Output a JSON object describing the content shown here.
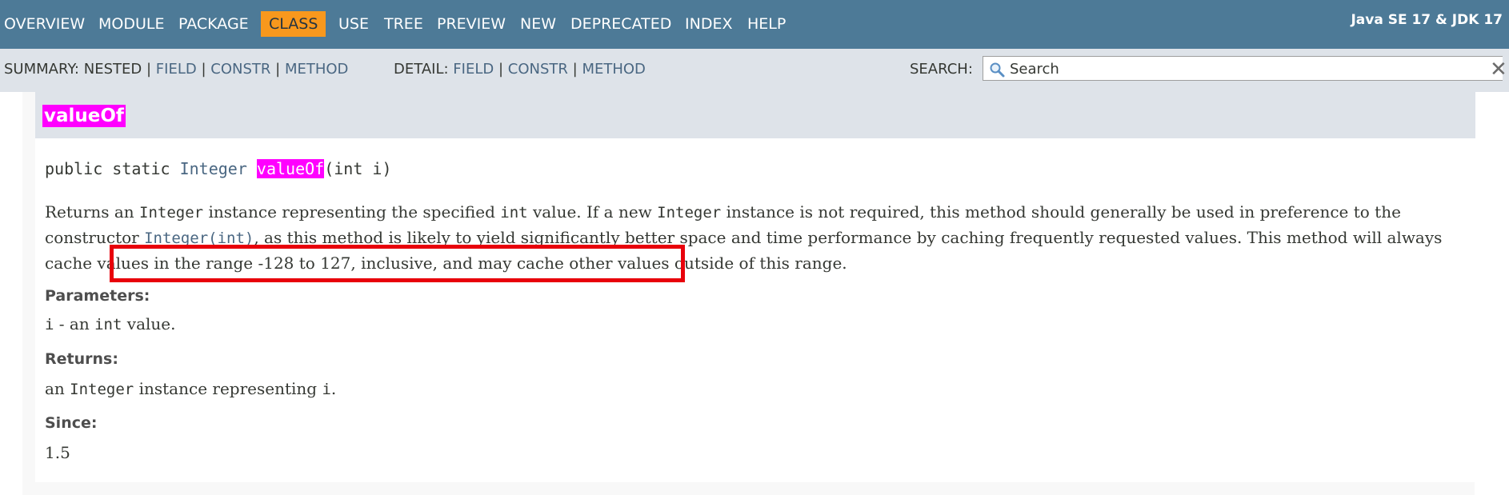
{
  "topnav": {
    "items": [
      {
        "label": "OVERVIEW"
      },
      {
        "label": "MODULE"
      },
      {
        "label": "PACKAGE"
      },
      {
        "label": "CLASS",
        "active": true
      },
      {
        "label": "USE"
      },
      {
        "label": "TREE"
      },
      {
        "label": "PREVIEW"
      },
      {
        "label": "NEW"
      },
      {
        "label": "DEPRECATED"
      },
      {
        "label": "INDEX"
      },
      {
        "label": "HELP"
      }
    ],
    "product": "Java SE 17 & JDK 17"
  },
  "subnav": {
    "summary_label": "SUMMARY:",
    "summary_nested": "NESTED",
    "summary_field": "FIELD",
    "summary_constr": "CONSTR",
    "summary_method": "METHOD",
    "detail_label": "DETAIL:",
    "detail_field": "FIELD",
    "detail_constr": "CONSTR",
    "detail_method": "METHOD",
    "sep": "|",
    "search_label": "SEARCH:",
    "search_placeholder": "Search"
  },
  "method": {
    "name": "valueOf",
    "sig_prefix": "public static ",
    "sig_type": "Integer",
    "sig_name": "valueOf",
    "sig_params": "(int i)",
    "desc_1": "Returns an ",
    "desc_code_integer": "Integer",
    "desc_2": " instance representing the specified ",
    "desc_code_int": "int",
    "desc_3": " value. If a new ",
    "desc_4": " instance is not required, this method should generally be used in preference to the constructor ",
    "desc_link": "Integer(int)",
    "desc_5": ", as this method is likely to yield significantly better space and time performance by caching frequently requested values. This method will always cache values in the range -128 to 127, inclusive, and may cache other values outside of this range.",
    "params_label": "Parameters:",
    "param_name": "i",
    "param_sep": " - an ",
    "param_code": "int",
    "param_desc": " value.",
    "returns_label": "Returns:",
    "returns_1": "an ",
    "returns_code": "Integer",
    "returns_2": " instance representing ",
    "returns_code_i": "i",
    "returns_3": ".",
    "since_label": "Since:",
    "since_value": "1.5"
  },
  "colors": {
    "nav_bg": "#4d7a97",
    "active_tab": "#f8981d",
    "subnav_bg": "#dee3e9",
    "link": "#4a6782",
    "highlight": "#ff00ff",
    "annotation_box": "#e8000b"
  }
}
